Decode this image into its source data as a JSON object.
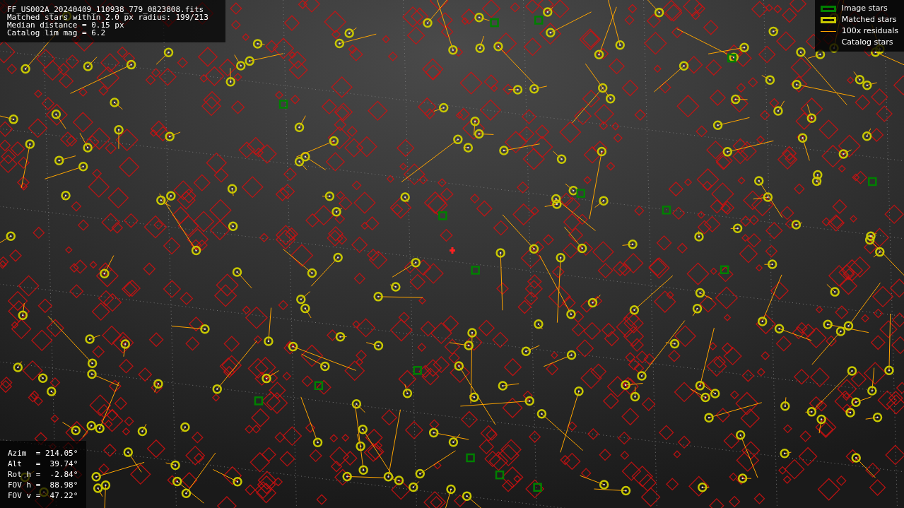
{
  "info_lines": [
    "FF_US002A_20240409_110938_779_0823808.fits",
    "Matched stars within 2.0 px radius: 199/213",
    "Median distance = 0.15 px",
    "Catalog lim mag = 6.2"
  ],
  "legend": [
    {
      "kind": "image",
      "label": "Image stars",
      "color": "#008000"
    },
    {
      "kind": "matched",
      "label": "Matched stars",
      "color": "#c8c800"
    },
    {
      "kind": "residual",
      "label": "100x residuals",
      "color": "#ffa500"
    },
    {
      "kind": "catalog",
      "label": "Catalog stars"
    }
  ],
  "pointing": [
    "Azim  = 214.05°",
    "Alt   =  39.74°",
    "Rot h =  -2.84°",
    "FOV h =  88.98°",
    "FOV v =  47.22°"
  ]
}
